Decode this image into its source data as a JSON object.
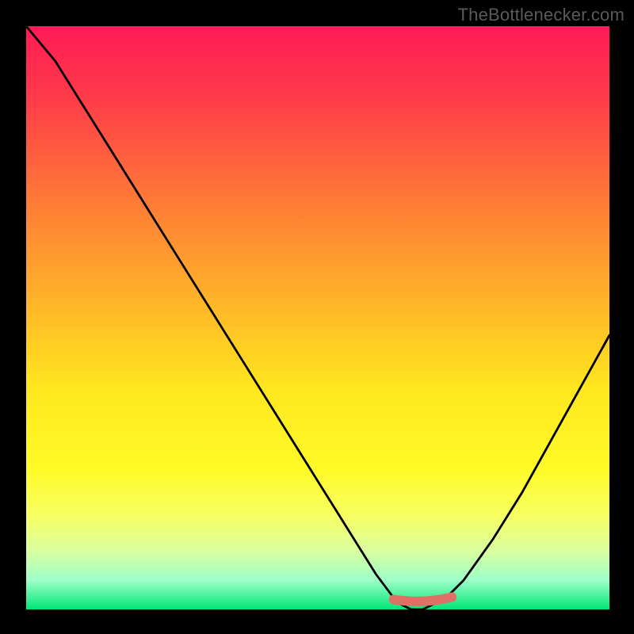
{
  "watermark": "TheBottlenecker.com",
  "colors": {
    "frame_bg": "#000000",
    "curve": "#000000",
    "marker": "#e07066",
    "gradient_stops": [
      {
        "t": 0.0,
        "c": "#ff1a56"
      },
      {
        "t": 0.12,
        "c": "#ff3a4a"
      },
      {
        "t": 0.3,
        "c": "#ff7a36"
      },
      {
        "t": 0.48,
        "c": "#ffb728"
      },
      {
        "t": 0.62,
        "c": "#ffe61e"
      },
      {
        "t": 0.76,
        "c": "#fffb28"
      },
      {
        "t": 0.84,
        "c": "#f7ff63"
      },
      {
        "t": 0.9,
        "c": "#d9ffa0"
      },
      {
        "t": 0.95,
        "c": "#9dffc8"
      },
      {
        "t": 1.0,
        "c": "#00e676"
      }
    ]
  },
  "chart_data": {
    "type": "line",
    "title": "",
    "xlabel": "",
    "ylabel": "",
    "xlim": [
      0,
      100
    ],
    "ylim": [
      0,
      100
    ],
    "series": [
      {
        "name": "bottleneck-curve",
        "x": [
          0,
          5,
          10,
          15,
          20,
          25,
          30,
          35,
          40,
          45,
          50,
          55,
          60,
          63,
          64,
          66,
          68,
          70,
          72,
          75,
          80,
          85,
          90,
          95,
          100
        ],
        "y": [
          100,
          94,
          86,
          78,
          70,
          62,
          54,
          46,
          38,
          30,
          22,
          14,
          6,
          2,
          1,
          0,
          0,
          1,
          2,
          5,
          12,
          20,
          29,
          38,
          47
        ]
      }
    ],
    "marker": {
      "note": "short flat segment at the bottleneck minimum",
      "x_start": 63,
      "x_end": 73,
      "y": 1.3
    }
  }
}
